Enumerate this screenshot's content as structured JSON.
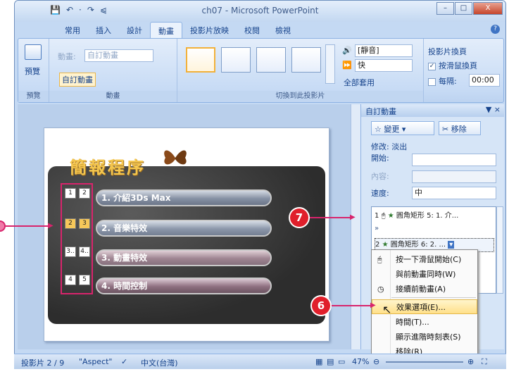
{
  "window": {
    "title": "ch07 - Microsoft PowerPoint"
  },
  "qat": {
    "save": "💾",
    "undo": "↶",
    "undo_more": "·",
    "redo": "↷",
    "more": "⩿"
  },
  "win_controls": {
    "minimize": "–",
    "maximize": "□",
    "close": "X"
  },
  "tabs": [
    "常用",
    "插入",
    "設計",
    "動畫",
    "投影片放映",
    "校閱",
    "檢視"
  ],
  "help": "?",
  "ribbon": {
    "preview_label": "預覽",
    "preview_group": "預覽",
    "animate_label": "動畫:",
    "animate_value": "自訂動畫",
    "custom_anim": "自訂動畫",
    "anim_group": "動畫",
    "transition_group": "切換到此投影片",
    "sound_value": "[靜音]",
    "speed_value": "快",
    "apply_all": "全部套用",
    "advance_title": "投影片換頁",
    "on_click": "按滑鼠換頁",
    "every": "每隔:",
    "every_value": "00:00"
  },
  "slide": {
    "title": "簡報程序",
    "items": [
      "1. 介紹3Ds Max",
      "2. 音樂特效",
      "3. 動畫特效",
      "4. 時間控制"
    ],
    "num_boxes": [
      [
        "1",
        "2"
      ],
      [
        "2",
        "3"
      ],
      [
        "3..",
        "4.."
      ],
      [
        "4",
        "5"
      ]
    ]
  },
  "pane": {
    "title": "自訂動畫",
    "close": "▼ ×",
    "change_btn": "變更",
    "remove_btn": "移除",
    "modify": "修改: 淡出",
    "start_label": "開始:",
    "property_label": "內容:",
    "speed_label": "速度:",
    "speed_value": "中",
    "rows": [
      {
        "num": "1",
        "text": "圓角矩形 5: 1. 介..."
      },
      {
        "num": "2",
        "text": "圓角矩形 6: 2. ..."
      },
      {
        "num": "3",
        "text": ""
      }
    ],
    "expand": "»",
    "bottom_check": "E"
  },
  "context_menu": [
    "按一下滑鼠開始(C)",
    "與前動畫同時(W)",
    "接續前動畫(A)",
    "效果選項(E)...",
    "時間(T)...",
    "顯示進階時刻表(S)",
    "移除(R)"
  ],
  "callouts": {
    "c7": "7",
    "c6": "6"
  },
  "status": {
    "slide": "投影片 2 / 9",
    "theme": "\"Aspect\"",
    "lang": "中文(台灣)",
    "zoom": "47%"
  }
}
